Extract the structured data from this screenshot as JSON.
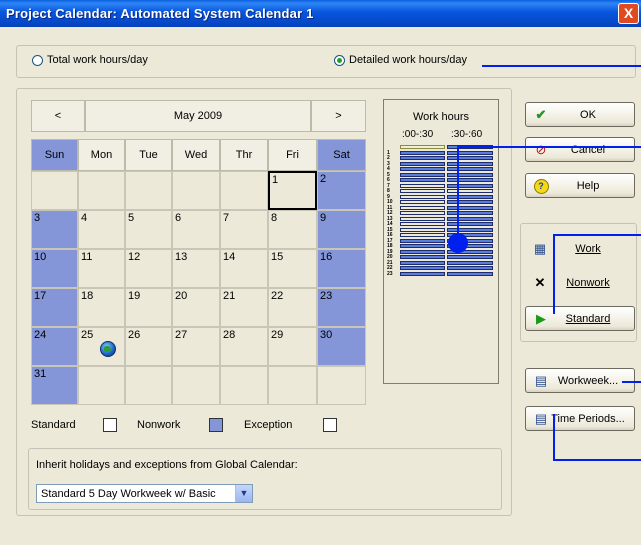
{
  "window": {
    "title": "Project Calendar: Automated System Calendar 1",
    "close_label": "X"
  },
  "mode": {
    "total_label": "Total work hours/day",
    "detailed_label": "Detailed work hours/day",
    "selected": "detailed"
  },
  "calendar": {
    "month_label": "May 2009",
    "prev_label": "<",
    "next_label": ">",
    "days": [
      "Sun",
      "Mon",
      "Tue",
      "Wed",
      "Thr",
      "Fri",
      "Sat"
    ],
    "weeks": [
      [
        "",
        "",
        "",
        "",
        "",
        "1",
        "2"
      ],
      [
        "3",
        "4",
        "5",
        "6",
        "7",
        "8",
        "9"
      ],
      [
        "10",
        "11",
        "12",
        "13",
        "14",
        "15",
        "16"
      ],
      [
        "17",
        "18",
        "19",
        "20",
        "21",
        "22",
        "23"
      ],
      [
        "24",
        "25",
        "26",
        "27",
        "28",
        "29",
        "30"
      ],
      [
        "31",
        "",
        "",
        "",
        "",
        "",
        ""
      ]
    ],
    "selected_day": "1",
    "globe_day": "25",
    "weekend_color": "#8496d8"
  },
  "legend": {
    "standard_label": "Standard",
    "nonwork_label": "Nonwork",
    "exception_label": "Exception"
  },
  "inherit": {
    "label": "Inherit holidays and exceptions from Global Calendar:",
    "selected": "Standard 5 Day Workweek w/ Basic"
  },
  "work_hours": {
    "title": "Work hours",
    "col1": ":00-:30",
    "col2": ":30-:60",
    "hours": [
      "1",
      "2",
      "3",
      "4",
      "5",
      "6",
      "7",
      "8",
      "9",
      "10",
      "11",
      "12",
      "13",
      "14",
      "15",
      "16",
      "17",
      "18",
      "19",
      "20",
      "21",
      "22",
      "23"
    ],
    "work_slots_col1": [
      0,
      1,
      2,
      3,
      4,
      5,
      6,
      17,
      18,
      19,
      20,
      21,
      22,
      23
    ],
    "work_slots_col2": [
      0,
      1,
      2,
      3,
      4,
      5,
      6,
      7,
      9,
      10,
      11,
      12,
      13,
      14,
      15,
      16,
      17,
      18,
      19,
      20,
      21,
      22,
      23
    ],
    "nonwork_color": "#5b7ddc",
    "work_color": "#ece9d8"
  },
  "buttons": {
    "ok": "OK",
    "cancel": "Cancel",
    "help": "Help",
    "work": "Work",
    "nonwork": "Nonwork",
    "standard": "Standard",
    "workweek": "Workweek...",
    "time_periods": "Time Periods..."
  },
  "icons": {
    "ok": "checkmark-icon",
    "cancel": "no-entry-icon",
    "help": "help-icon",
    "work": "work-calendar-icon",
    "nonwork": "x-icon",
    "standard": "play-arrow-icon",
    "workweek": "workweek-icon",
    "time_periods": "time-periods-icon",
    "globe": "globe-icon"
  }
}
